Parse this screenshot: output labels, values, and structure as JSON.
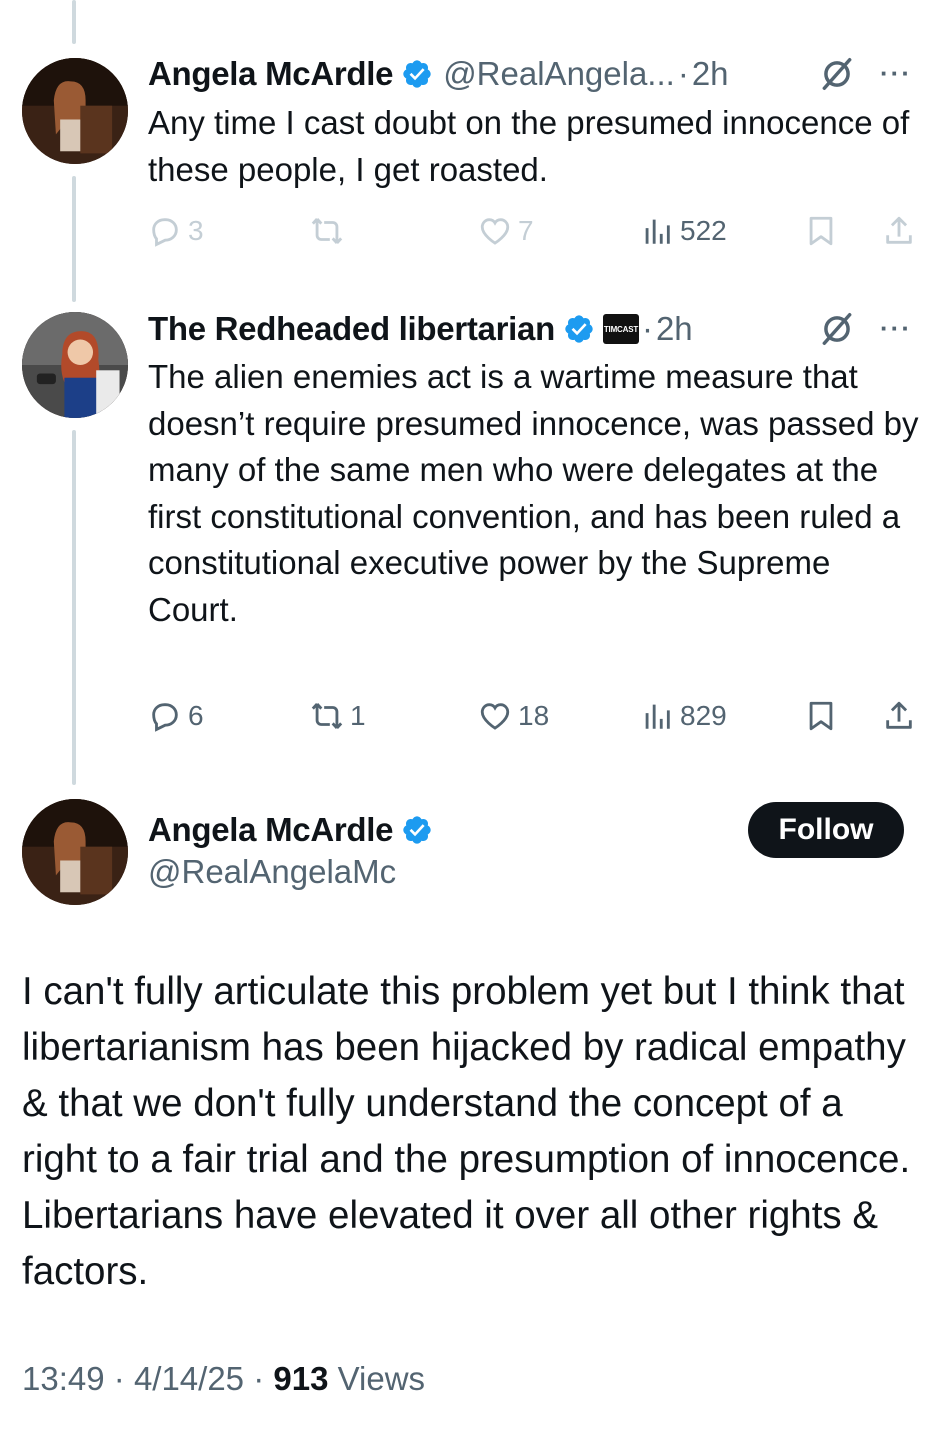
{
  "tweets": [
    {
      "name": "Angela McArdle",
      "handle": "@RealAngela...",
      "time": "2h",
      "text": "Any time I cast doubt on the presumed innocence of these people, I get roasted.",
      "stats": {
        "replies": "3",
        "retweets": "",
        "likes": "7",
        "views": "522"
      }
    },
    {
      "name": "The Redheaded libertarian",
      "badge": "TIMCAST",
      "time": "2h",
      "text": "The alien enemies act is a wartime measure that doesn’t require presumed innocence, was passed by many of the same men who were delegates at the first constitutional convention, and has been ruled a constitutional executive power by the Supreme Court.",
      "stats": {
        "replies": "6",
        "retweets": "1",
        "likes": "18",
        "views": "829"
      }
    }
  ],
  "main": {
    "name": "Angela McArdle",
    "handle": "@RealAngelaMc",
    "follow_label": "Follow",
    "text": "I can't fully articulate this problem yet but I think that libertarianism has been hijacked by radical empathy & that we don't fully understand the concept of a right to a fair trial and the presumption of innocence. Libertarians have elevated it over all other rights & factors.",
    "time": "13:49",
    "date": "4/14/25",
    "views_count": "913",
    "views_label": "Views"
  },
  "separator": "·",
  "more_label": "···",
  "icons": [
    "verified-badge-icon",
    "grok-icon",
    "more-icon",
    "reply-icon",
    "retweet-icon",
    "like-icon",
    "views-icon",
    "bookmark-icon",
    "share-icon"
  ],
  "colors": {
    "verified": "#1d9bf0",
    "text": "#0f1419",
    "secondary": "#536471",
    "faded": "#c4ced5",
    "thread": "#cfd9de"
  }
}
